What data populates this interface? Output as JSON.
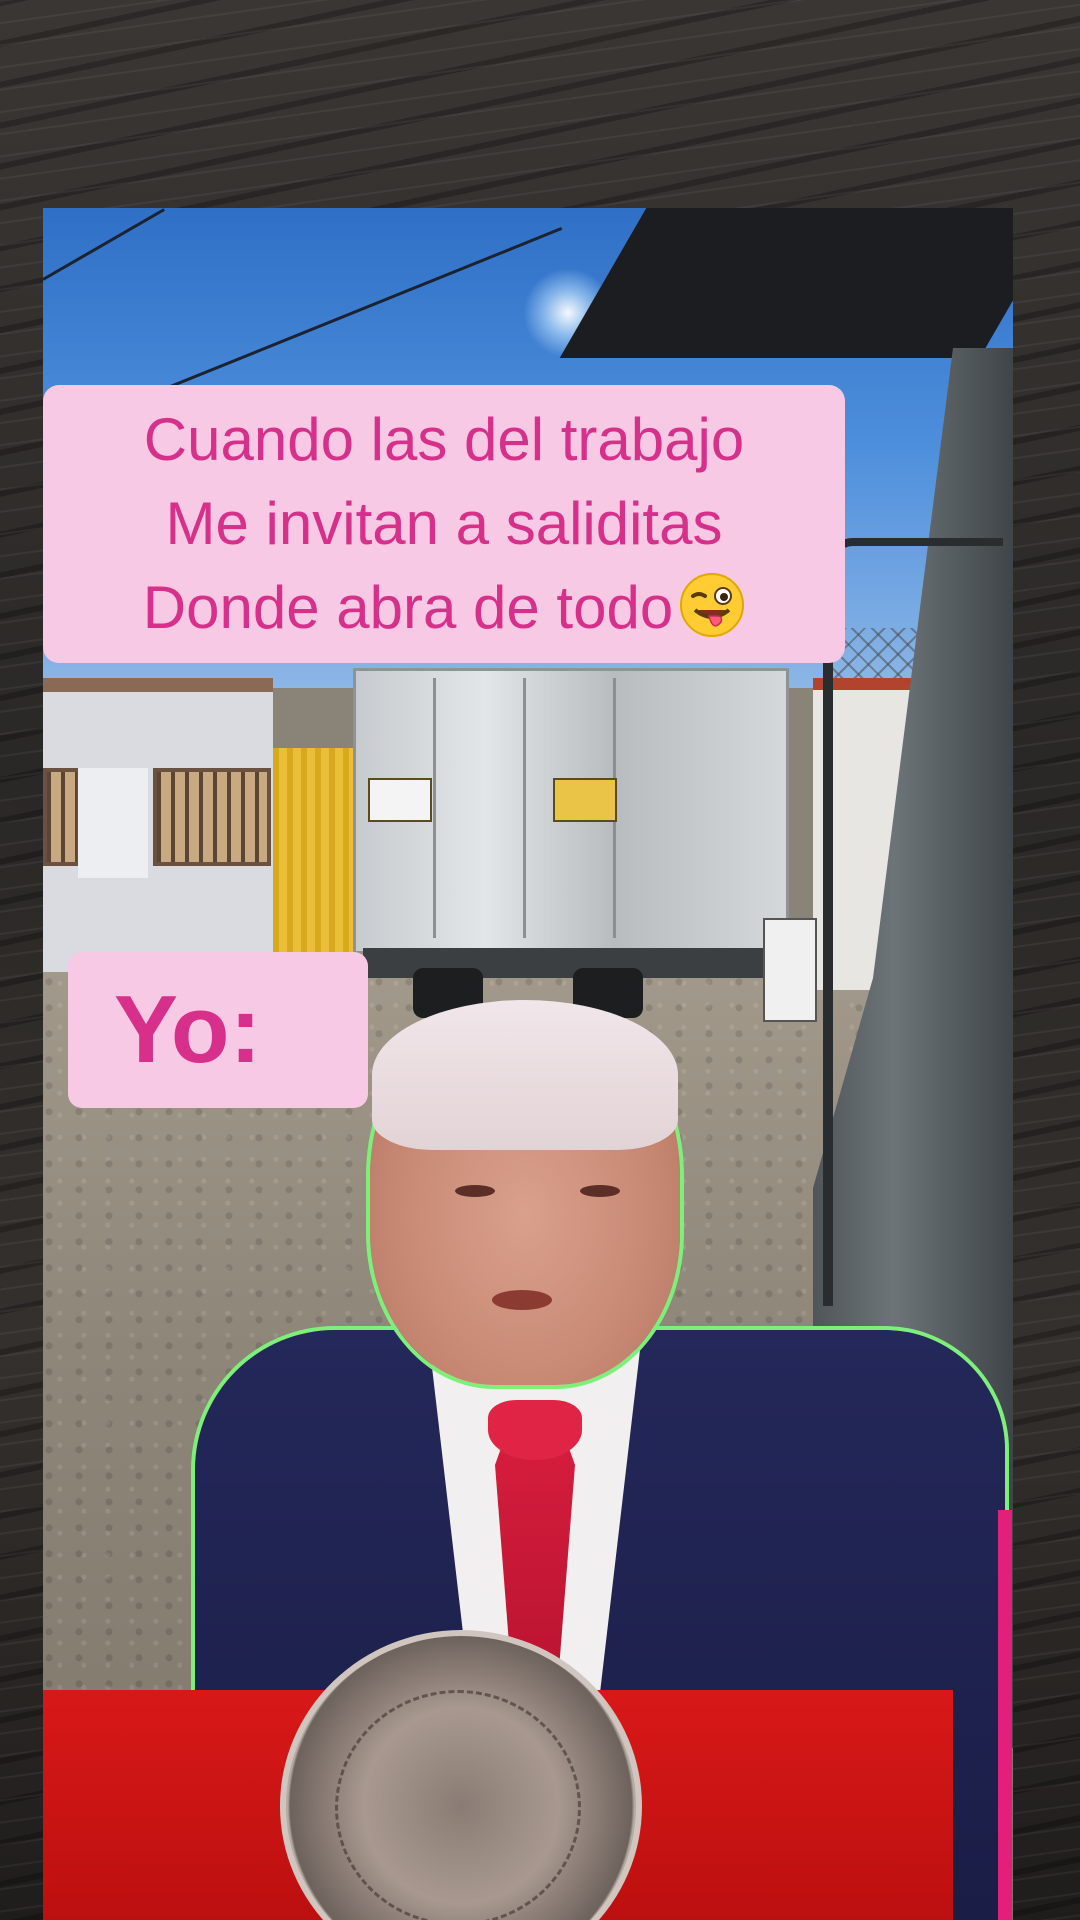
{
  "caption": {
    "lines": [
      "Cuando las del trabajo",
      "Me invitan a saliditas",
      "Donde abra de todo"
    ],
    "emoji": "winking-face-with-tongue-icon"
  },
  "reaction": {
    "label": "Yo:"
  },
  "colors": {
    "caption_bg": "#f8c9e4",
    "caption_text": "#d6308a",
    "podium": "#d81818",
    "outline": "#7ef07a"
  }
}
